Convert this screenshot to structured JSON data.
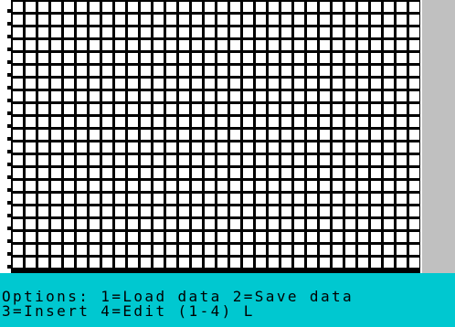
{
  "colors": {
    "border": "#c0c0c0",
    "grid_lines": "#000000",
    "grid_cells": "#ffffff",
    "status_bar": "#00c8d0",
    "status_text": "#000000"
  },
  "grid": {
    "columns": 32,
    "rows": 21
  },
  "status": {
    "line1": "Options: 1=Load data 2=Save data",
    "line2": "3=Insert 4=Edit (1-4) L"
  }
}
